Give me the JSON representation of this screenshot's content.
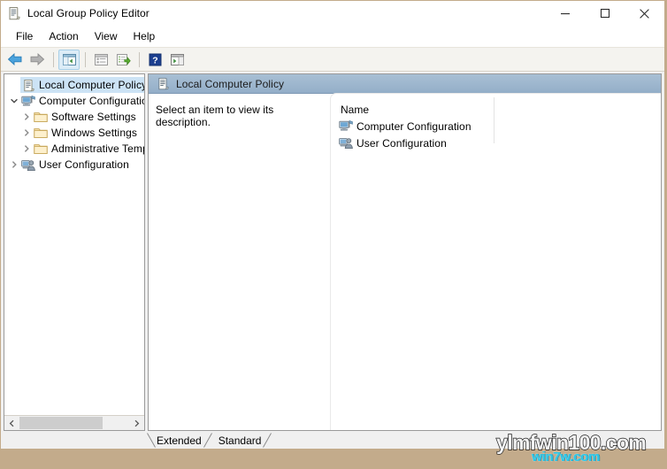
{
  "window": {
    "title": "Local Group Policy Editor",
    "title_icon": "policy-document-icon",
    "border_color": "#c3ab8b",
    "caption": {
      "minimize_label": "Minimize",
      "maximize_label": "Maximize",
      "close_label": "Close"
    }
  },
  "menubar": {
    "items": [
      {
        "label": "File"
      },
      {
        "label": "Action"
      },
      {
        "label": "View"
      },
      {
        "label": "Help"
      }
    ]
  },
  "toolbar": {
    "buttons": [
      {
        "name": "back-button",
        "icon": "left-arrow-icon",
        "enabled": true
      },
      {
        "name": "forward-button",
        "icon": "right-arrow-icon",
        "enabled": false
      },
      {
        "name": "show-hide-tree-button",
        "icon": "console-tree-icon",
        "pressed": true
      },
      {
        "name": "properties-button",
        "icon": "properties-window-icon",
        "enabled": false
      },
      {
        "name": "export-list-button",
        "icon": "export-list-icon",
        "enabled": true
      },
      {
        "name": "help-button",
        "icon": "question-mark-icon",
        "enabled": true
      },
      {
        "name": "show-action-pane-button",
        "icon": "action-pane-icon",
        "enabled": true
      }
    ]
  },
  "tree": {
    "items": [
      {
        "label": "Local Computer Policy",
        "icon": "policy-document-icon",
        "chevron": "none",
        "indent": 1,
        "selected": true
      },
      {
        "label": "Computer Configuration",
        "icon": "computer-icon",
        "chevron": "expanded",
        "indent": 1,
        "selected": false
      },
      {
        "label": "Software Settings",
        "icon": "folder-icon",
        "chevron": "collapsed",
        "indent": 2,
        "selected": false
      },
      {
        "label": "Windows Settings",
        "icon": "folder-icon",
        "chevron": "collapsed",
        "indent": 2,
        "selected": false
      },
      {
        "label": "Administrative Templates",
        "icon": "folder-icon",
        "chevron": "collapsed",
        "indent": 2,
        "selected": false
      },
      {
        "label": "User Configuration",
        "icon": "user-icon",
        "chevron": "collapsed",
        "indent": 1,
        "selected": false
      }
    ],
    "hscroll": {
      "left_arrow": "‹",
      "right_arrow": "›"
    }
  },
  "content": {
    "header": {
      "title": "Local Computer Policy",
      "icon": "policy-document-icon"
    },
    "description": "Select an item to view its description.",
    "list": {
      "column_header": "Name",
      "rows": [
        {
          "label": "Computer Configuration",
          "icon": "computer-icon"
        },
        {
          "label": "User Configuration",
          "icon": "user-icon"
        }
      ]
    }
  },
  "tabs": [
    {
      "label": "Extended",
      "active": true
    },
    {
      "label": "Standard",
      "active": false
    }
  ],
  "watermarks": {
    "primary": "ylmfwin100.com",
    "secondary": "win7w.com",
    "primary_color": "#f2f2f2",
    "secondary_color": "#2ac8e8"
  }
}
